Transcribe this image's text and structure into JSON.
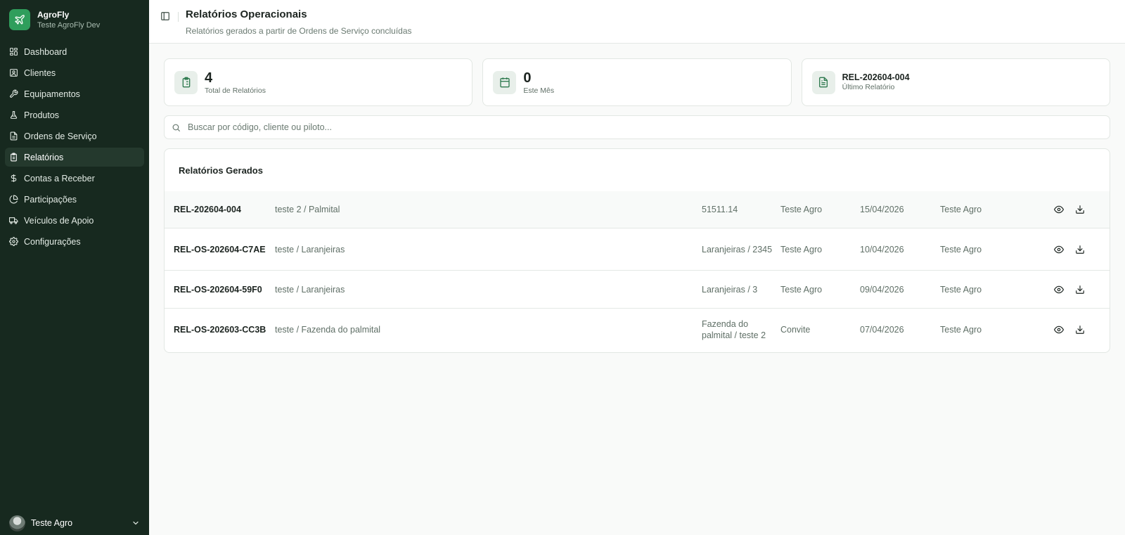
{
  "app": {
    "name": "AgroFly",
    "workspace": "Teste AgroFly Dev"
  },
  "sidebar": {
    "items": [
      {
        "label": "Dashboard",
        "icon": "grid-icon"
      },
      {
        "label": "Clientes",
        "icon": "contact-icon"
      },
      {
        "label": "Equipamentos",
        "icon": "wrench-icon"
      },
      {
        "label": "Produtos",
        "icon": "flask-icon"
      },
      {
        "label": "Ordens de Serviço",
        "icon": "document-icon"
      },
      {
        "label": "Relatórios",
        "icon": "clipboard-icon",
        "active": true
      },
      {
        "label": "Contas a Receber",
        "icon": "dollar-icon"
      },
      {
        "label": "Participações",
        "icon": "pie-chart-icon"
      },
      {
        "label": "Veículos de Apoio",
        "icon": "truck-icon"
      },
      {
        "label": "Configurações",
        "icon": "gear-icon"
      }
    ],
    "user": {
      "name": "Teste Agro"
    }
  },
  "header": {
    "title": "Relatórios Operacionais",
    "subtitle": "Relatórios gerados a partir de Ordens de Serviço concluídas"
  },
  "stats": [
    {
      "value": "4",
      "label": "Total de Relatórios",
      "icon": "clipboard-list-icon"
    },
    {
      "value": "0",
      "label": "Este Mês",
      "icon": "calendar-icon"
    },
    {
      "value": "REL-202604-004",
      "label": "Último Relatório",
      "icon": "file-text-icon"
    }
  ],
  "search": {
    "placeholder": "Buscar por código, cliente ou piloto...",
    "value": ""
  },
  "reports": {
    "title": "Relatórios Gerados",
    "rows": [
      {
        "code": "REL-202604-004",
        "client": "teste 2 / Palmital",
        "area": "51511.14",
        "pilot": "Teste Agro",
        "date": "15/04/2026",
        "author": "Teste Agro"
      },
      {
        "code": "REL-OS-202604-C7AE",
        "client": "teste / Laranjeiras",
        "area": "Laranjeiras / 2345",
        "pilot": "Teste Agro",
        "date": "10/04/2026",
        "author": "Teste Agro"
      },
      {
        "code": "REL-OS-202604-59F0",
        "client": "teste / Laranjeiras",
        "area": "Laranjeiras / 3",
        "pilot": "Teste Agro",
        "date": "09/04/2026",
        "author": "Teste Agro"
      },
      {
        "code": "REL-OS-202603-CC3B",
        "client": "teste / Fazenda do palmital",
        "area": "Fazenda do palmital / teste 2",
        "pilot": "Convite",
        "date": "07/04/2026",
        "author": "Teste Agro"
      }
    ]
  },
  "colors": {
    "sidebar_bg": "#17291f",
    "brand_accent": "#2f9e5c",
    "icon_accent": "#2f7a4f"
  }
}
